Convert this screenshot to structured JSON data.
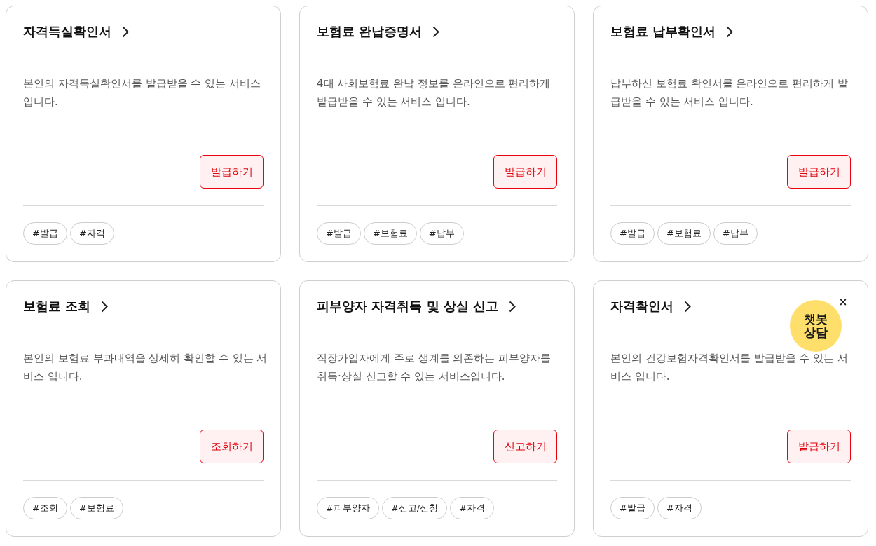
{
  "cards": [
    {
      "title": "자격득실확인서",
      "description": "본인의 자격득실확인서를 발급받을 수 있는 서비스 입니다.",
      "action": "발급하기",
      "tags": [
        "#발급",
        "#자격"
      ]
    },
    {
      "title": "보험료 완납증명서",
      "description": "4대 사회보험료 완납 정보를 온라인으로 편리하게 발급받을 수 있는 서비스 입니다.",
      "action": "발급하기",
      "tags": [
        "#발급",
        "#보험료",
        "#납부"
      ]
    },
    {
      "title": "보험료 납부확인서",
      "description": "납부하신 보험료 확인서를 온라인으로 편리하게 발급받을 수 있는 서비스 입니다.",
      "action": "발급하기",
      "tags": [
        "#발급",
        "#보험료",
        "#납부"
      ]
    },
    {
      "title": "보험료 조회",
      "description": "본인의 보험료 부과내역을 상세히 확인할 수 있는 서비스 입니다.",
      "action": "조회하기",
      "tags": [
        "#조회",
        "#보험료"
      ]
    },
    {
      "title": "피부양자 자격취득 및 상실 신고",
      "description": "직장가입자에게 주로 생계를 의존하는 피부양자를 취득·상실 신고할 수 있는 서비스입니다.",
      "action": "신고하기",
      "tags": [
        "#피부양자",
        "#신고/신청",
        "#자격"
      ]
    },
    {
      "title": "자격확인서",
      "description": "본인의 건강보험자격확인서를 발급받을 수 있는 서비스 입니다.",
      "action": "발급하기",
      "tags": [
        "#발급",
        "#자격"
      ]
    }
  ],
  "chatbot": {
    "label": "챗봇 상담",
    "close": "×"
  }
}
